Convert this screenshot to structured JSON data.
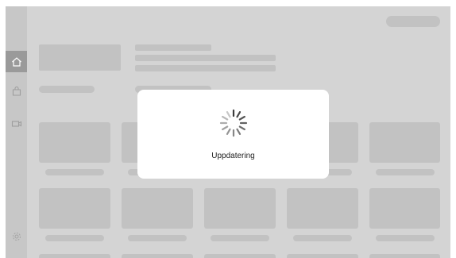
{
  "app": {
    "nav": [
      {
        "icon": "home-icon",
        "active": true
      },
      {
        "icon": "shopping-bag-icon",
        "active": false
      },
      {
        "icon": "video-camera-icon",
        "active": false
      },
      {
        "icon": "settings-gear-icon",
        "active": false
      }
    ]
  },
  "dialog": {
    "message": "Uppdatering",
    "spinner_icon": "loading-spinner-icon"
  },
  "colors": {
    "dim_background": "#d4d4d4",
    "sidebar": "#c7c7c7",
    "active_nav": "#9a9a9a",
    "placeholder": "#c2c2c2",
    "dialog": "#ffffff"
  }
}
